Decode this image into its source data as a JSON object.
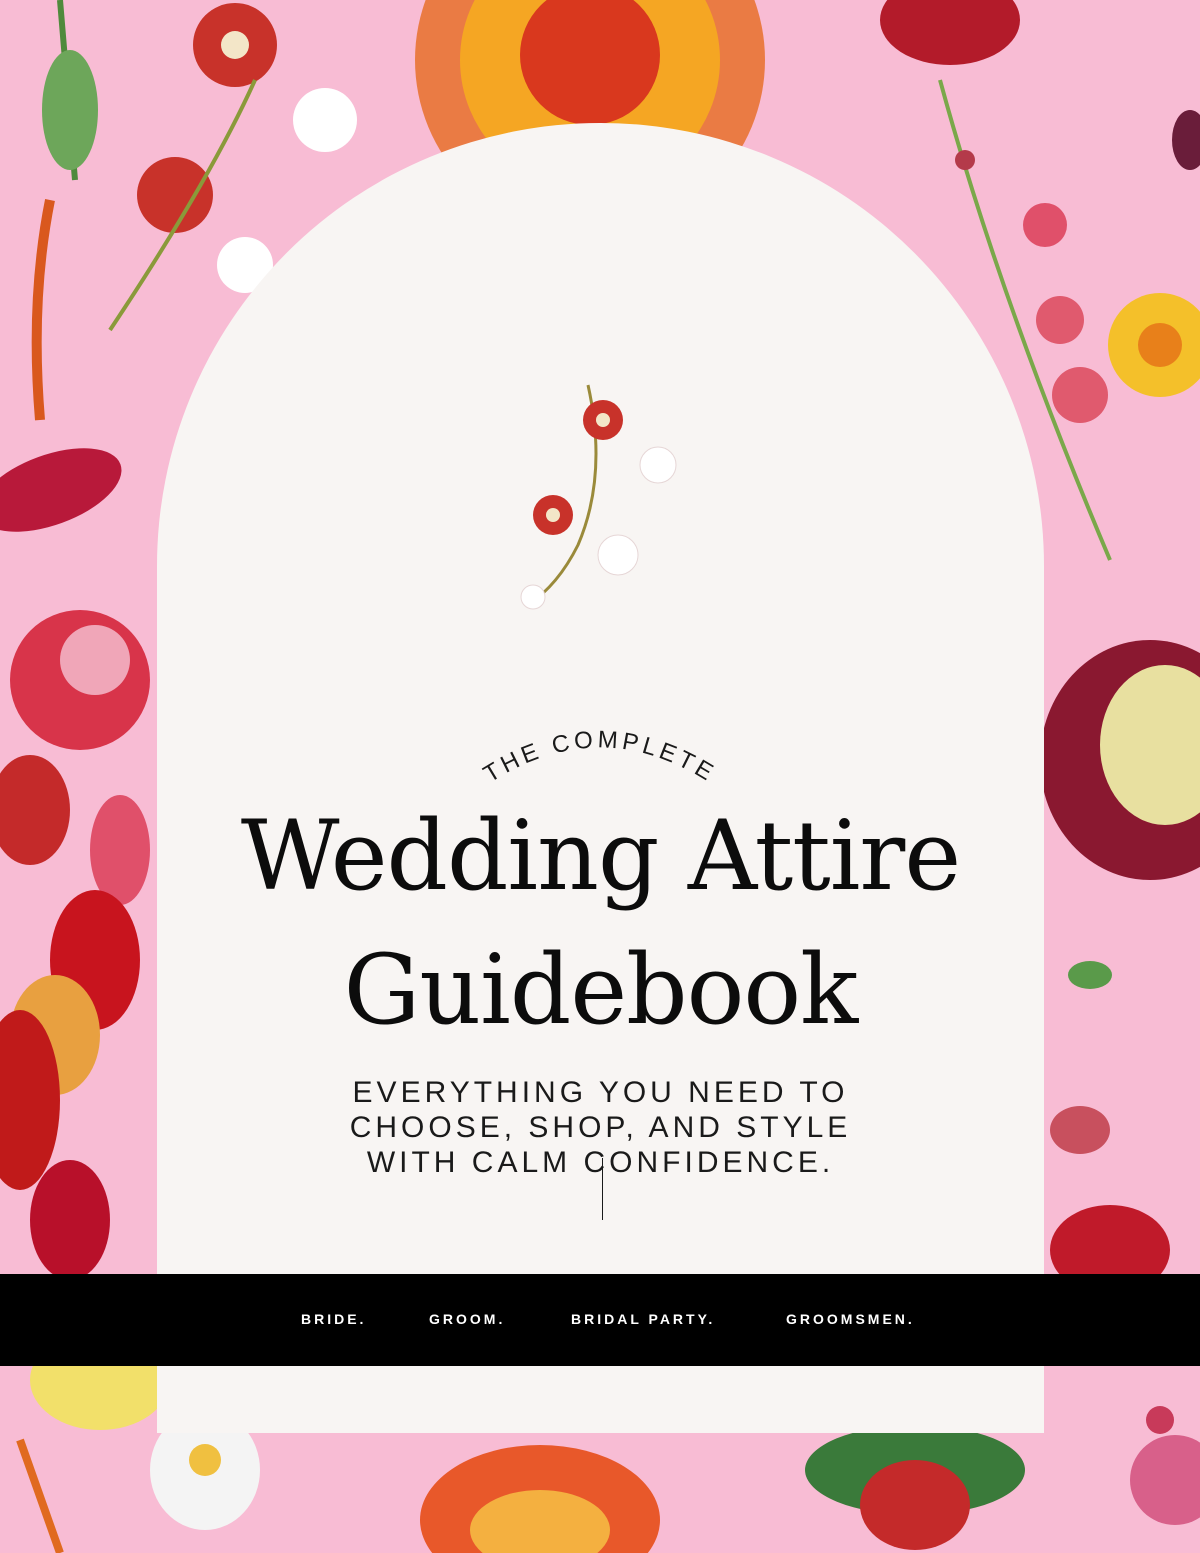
{
  "cover": {
    "eyebrow": "THE COMPLETE",
    "title_line1": "Wedding Attire",
    "title_line2": "Guidebook",
    "subtitle_lines": [
      "EVERYTHING YOU NEED TO",
      "CHOOSE, SHOP, AND STYLE",
      "WITH CALM CONFIDENCE."
    ]
  },
  "band": {
    "items": [
      "BRIDE.",
      "GROOM.",
      "BRIDAL PARTY.",
      "GROOMSMEN."
    ]
  },
  "colors": {
    "background": "#f8bcd4",
    "arch": "#f8f5f3",
    "band": "#000000",
    "text": "#0c0c0c"
  }
}
